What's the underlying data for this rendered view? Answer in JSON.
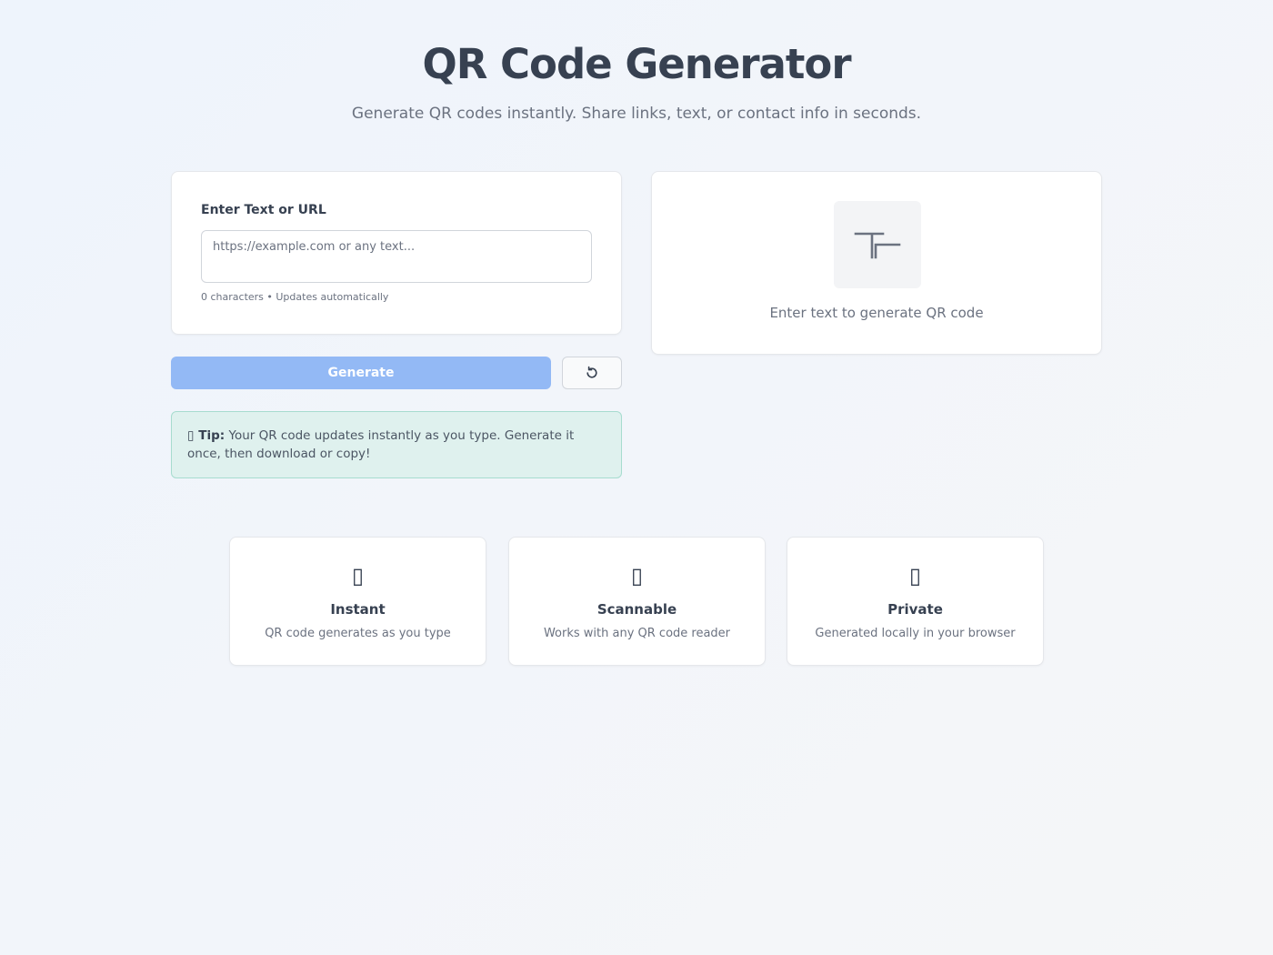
{
  "header": {
    "title": "QR Code Generator",
    "subtitle": "Generate QR codes instantly. Share links, text, or contact info in seconds."
  },
  "input_card": {
    "label": "Enter Text or URL",
    "placeholder": "https://example.com or any text...",
    "value": "",
    "hint": "0 characters • Updates automatically"
  },
  "actions": {
    "generate_label": "Generate",
    "reset_icon": "refresh-icon"
  },
  "tip": {
    "icon": "▯",
    "label": "Tip:",
    "text": " Your QR code updates instantly as you type. Generate it once, then download or copy!"
  },
  "preview": {
    "placeholder_icon": "text-cursor-icon",
    "message": "Enter text to generate QR code"
  },
  "features": [
    {
      "icon": "▯",
      "title": "Instant",
      "description": "QR code generates as you type"
    },
    {
      "icon": "▯",
      "title": "Scannable",
      "description": "Works with any QR code reader"
    },
    {
      "icon": "▯",
      "title": "Private",
      "description": "Generated locally in your browser"
    }
  ],
  "colors": {
    "primary_disabled": "#93b9f5",
    "tip_background": "#dff1ee",
    "tip_border": "#a7dccf",
    "text_primary": "#374151",
    "text_muted": "#6b7280"
  }
}
